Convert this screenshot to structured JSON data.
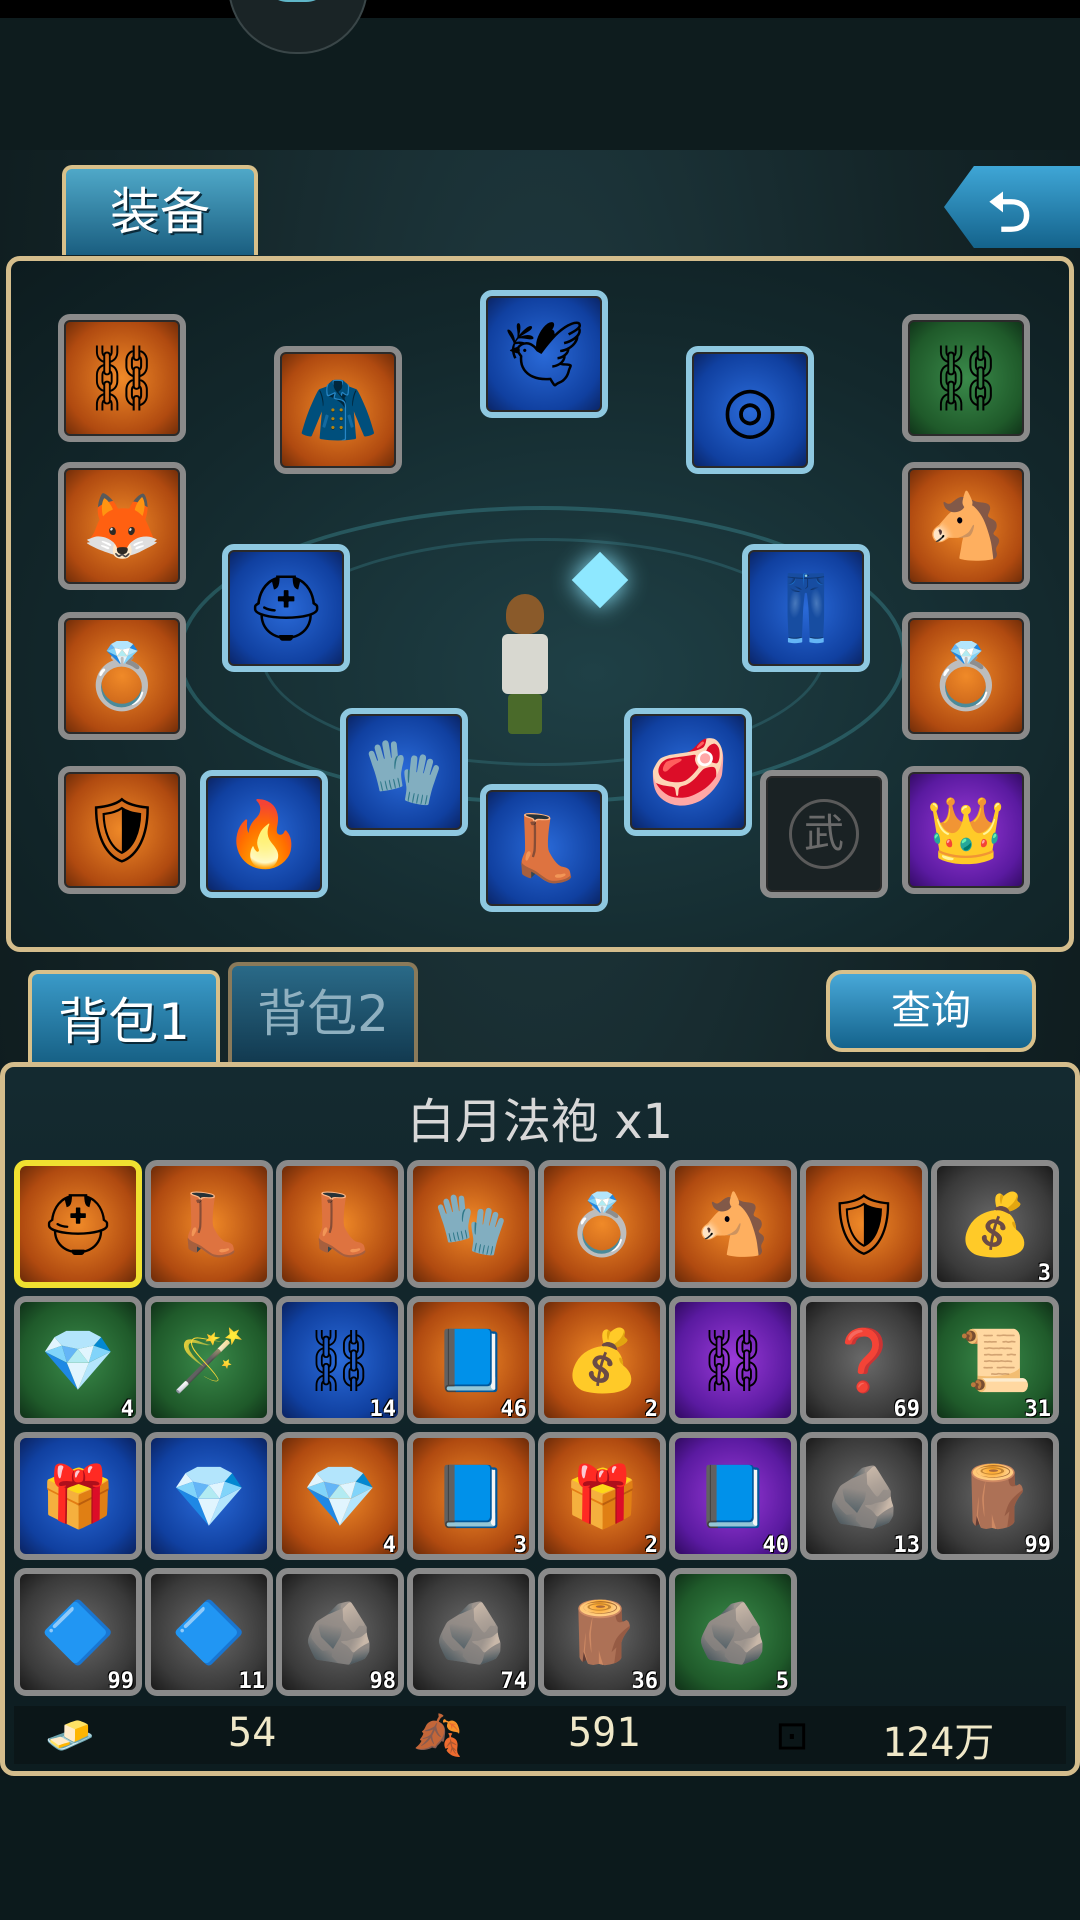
{
  "tabs": {
    "equip": "装备",
    "bag1": "背包1",
    "bag2": "背包2"
  },
  "back_label": "⮌",
  "query_label": "查询",
  "selected_item": "白月法袍 x1",
  "equip_slots": [
    {
      "name": "necklace-left",
      "icon": "⛓",
      "color": "o"
    },
    {
      "name": "robe",
      "icon": "🧥",
      "color": "o"
    },
    {
      "name": "wings",
      "icon": "🕊",
      "color": "b"
    },
    {
      "name": "bracer",
      "icon": "◎",
      "color": "b"
    },
    {
      "name": "necklace-right",
      "icon": "⛓",
      "color": "g"
    },
    {
      "name": "fox-pet",
      "icon": "🦊",
      "color": "o"
    },
    {
      "name": "horse-mount",
      "icon": "🐴",
      "color": "o"
    },
    {
      "name": "helmet",
      "icon": "⛑",
      "color": "b"
    },
    {
      "name": "pants",
      "icon": "👖",
      "color": "b"
    },
    {
      "name": "ring-left",
      "icon": "💍",
      "color": "o"
    },
    {
      "name": "ring-right",
      "icon": "💍",
      "color": "o"
    },
    {
      "name": "gloves",
      "icon": "🧤",
      "color": "b"
    },
    {
      "name": "belt",
      "icon": "🥩",
      "color": "b"
    },
    {
      "name": "armor",
      "icon": "🛡",
      "color": "o"
    },
    {
      "name": "orb",
      "icon": "🔥",
      "color": "b"
    },
    {
      "name": "boots",
      "icon": "👢",
      "color": "b"
    },
    {
      "name": "weapon-empty",
      "icon": "武",
      "color": "dk"
    },
    {
      "name": "vip-crown",
      "icon": "👑",
      "color": "p"
    }
  ],
  "inventory": [
    {
      "icon": "⛑",
      "color": "o",
      "qty": "",
      "selected": true
    },
    {
      "icon": "👢",
      "color": "o",
      "qty": ""
    },
    {
      "icon": "👢",
      "color": "o",
      "qty": ""
    },
    {
      "icon": "🧤",
      "color": "o",
      "qty": ""
    },
    {
      "icon": "💍",
      "color": "o",
      "qty": ""
    },
    {
      "icon": "🐴",
      "color": "o",
      "qty": ""
    },
    {
      "icon": "🛡",
      "color": "o",
      "qty": ""
    },
    {
      "icon": "💰",
      "color": "gr",
      "qty": "3"
    },
    {
      "icon": "💎",
      "color": "g",
      "qty": "4"
    },
    {
      "icon": "🪄",
      "color": "g",
      "qty": ""
    },
    {
      "icon": "⛓",
      "color": "b",
      "qty": "14"
    },
    {
      "icon": "📘",
      "color": "o",
      "qty": "46"
    },
    {
      "icon": "💰",
      "color": "o",
      "qty": "2"
    },
    {
      "icon": "⛓",
      "color": "p",
      "qty": ""
    },
    {
      "icon": "❓",
      "color": "gr",
      "qty": "69"
    },
    {
      "icon": "📜",
      "color": "g",
      "qty": "31"
    },
    {
      "icon": "🎁",
      "color": "b",
      "qty": ""
    },
    {
      "icon": "💎",
      "color": "b",
      "qty": ""
    },
    {
      "icon": "💎",
      "color": "o",
      "qty": "4"
    },
    {
      "icon": "📘",
      "color": "o",
      "qty": "3"
    },
    {
      "icon": "🎁",
      "color": "o",
      "qty": "2"
    },
    {
      "icon": "📘",
      "color": "p",
      "qty": "40"
    },
    {
      "icon": "🪨",
      "color": "gr",
      "qty": "13"
    },
    {
      "icon": "🪵",
      "color": "gr",
      "qty": "99"
    },
    {
      "icon": "🔷",
      "color": "gr",
      "qty": "99"
    },
    {
      "icon": "🔷",
      "color": "gr",
      "qty": "11"
    },
    {
      "icon": "🪨",
      "color": "gr",
      "qty": "98"
    },
    {
      "icon": "🪨",
      "color": "gr",
      "qty": "74"
    },
    {
      "icon": "🪵",
      "color": "gr",
      "qty": "36"
    },
    {
      "icon": "🪨",
      "color": "g",
      "qty": "5"
    }
  ],
  "currency": [
    {
      "icon": "gold-ingot-icon",
      "glyph": "🧈",
      "value": "54"
    },
    {
      "icon": "leaf-icon",
      "glyph": "🍂",
      "value": "591"
    },
    {
      "icon": "coin-icon",
      "glyph": "⊡",
      "value": "124万"
    }
  ]
}
